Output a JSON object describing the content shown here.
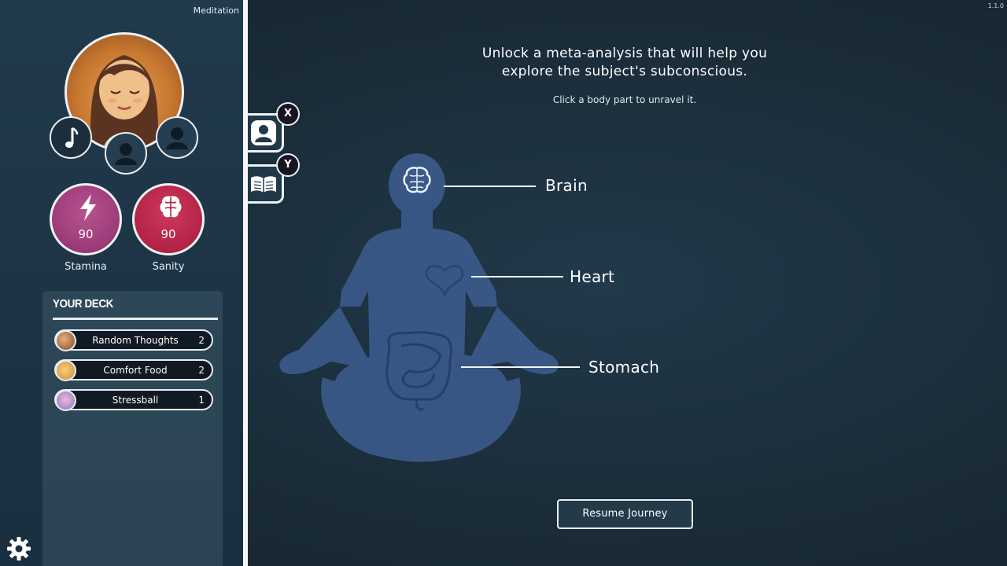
{
  "window": {
    "scene_title": "Meditation",
    "version": "1.1.0"
  },
  "sidebar": {
    "stats": [
      {
        "name": "Stamina",
        "value": "90",
        "icon": "lightning-icon",
        "color": "#9a3a78"
      },
      {
        "name": "Sanity",
        "value": "90",
        "icon": "brain-icon",
        "color": "#b3224a"
      }
    ],
    "deck": {
      "title": "YOUR DECK",
      "cards": [
        {
          "name": "Random Thoughts",
          "count": "2"
        },
        {
          "name": "Comfort Food",
          "count": "2"
        },
        {
          "name": "Stressball",
          "count": "1"
        }
      ]
    }
  },
  "tabs": [
    {
      "icon": "profile-icon",
      "key": "X"
    },
    {
      "icon": "journal-icon",
      "key": "Y"
    }
  ],
  "main": {
    "heading": "Unlock a meta-analysis that will help you explore the subject's subconscious.",
    "subheading": "Click a body part to unravel it.",
    "body_parts": [
      {
        "name": "Brain"
      },
      {
        "name": "Heart"
      },
      {
        "name": "Stomach"
      }
    ],
    "resume_label": "Resume Journey"
  },
  "colors": {
    "figure": "#3b5a8a",
    "background": "#1d2f3c",
    "outline": "#eef2f5"
  }
}
